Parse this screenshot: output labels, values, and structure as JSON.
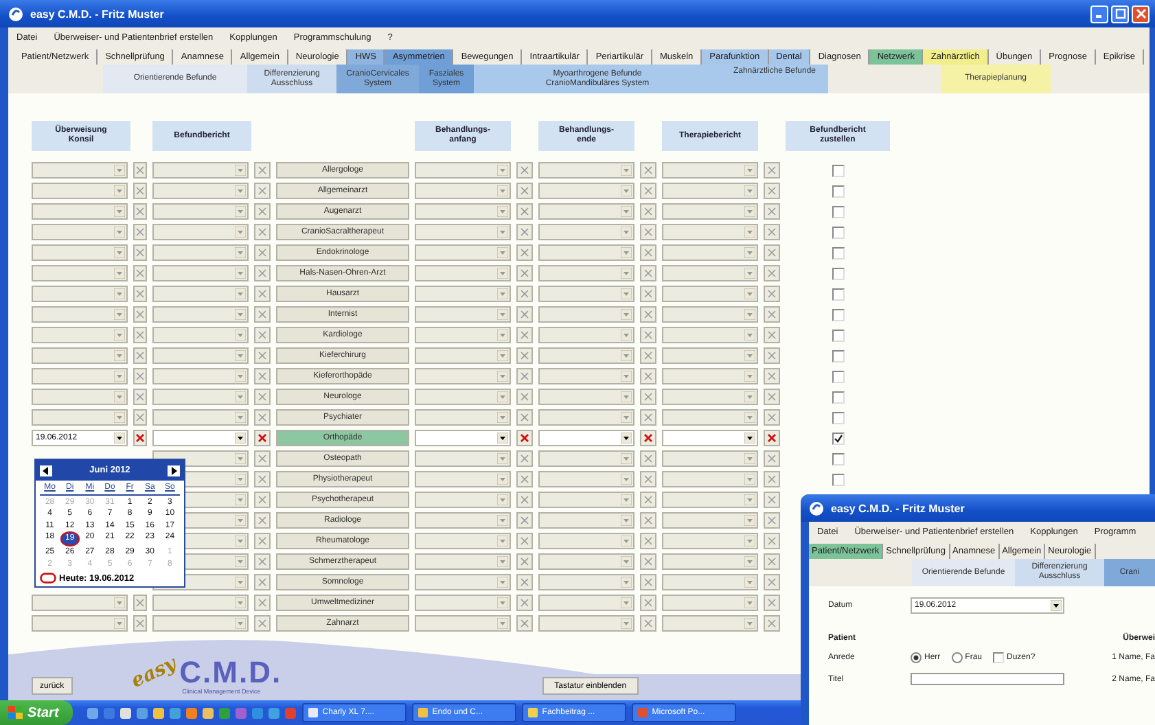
{
  "window": {
    "title": "easy C.M.D. - Fritz Muster"
  },
  "menu": [
    "Datei",
    "Überweiser- und Patientenbrief erstellen",
    "Kopplungen",
    "Programmschulung",
    "?"
  ],
  "tabs": [
    {
      "label": "Patient/Netzwerk",
      "selected": false
    },
    {
      "label": "Schnellprüfung",
      "selected": false
    },
    {
      "label": "Anamnese",
      "selected": false
    },
    {
      "label": "Allgemein",
      "selected": false
    },
    {
      "label": "Neurologie",
      "selected": false
    },
    {
      "label": "HWS",
      "selected": false,
      "color": "#8fb4e0"
    },
    {
      "label": "Asymmetrien",
      "selected": false,
      "color": "#6f9fd6"
    },
    {
      "label": "Bewegungen",
      "selected": false
    },
    {
      "label": "Intraartikulär",
      "selected": false
    },
    {
      "label": "Periartikulär",
      "selected": false
    },
    {
      "label": "Muskeln",
      "selected": false
    },
    {
      "label": "Parafunktion",
      "selected": false,
      "color": "#a6c6ea"
    },
    {
      "label": "Dental",
      "selected": false,
      "color": "#a6c6ea"
    },
    {
      "label": "Diagnosen",
      "selected": false
    },
    {
      "label": "Netzwerk",
      "selected": true
    },
    {
      "label": "Zahnärztlich",
      "selected": false,
      "color": "#f2ee8c"
    },
    {
      "label": "Übungen",
      "selected": false
    },
    {
      "label": "Prognose",
      "selected": false
    },
    {
      "label": "Epikrise",
      "selected": false
    }
  ],
  "subtabs": [
    {
      "label": "Orientierende Befunde",
      "color": "#e3e9f2"
    },
    {
      "label": "Differenzierung\nAusschluss",
      "color": "#cddcee"
    },
    {
      "label": "CranioCervicales\nSystem",
      "color": "#7fa9d9"
    },
    {
      "label": "Fasziales\nSystem",
      "color": "#6f9fd6"
    },
    {
      "label": "Myoarthrogene Befunde\nCranioMandibuläres System",
      "color": "#a9c9ec"
    },
    {
      "label": "Zahnärztliche Befunde",
      "color": "#a9c9ec"
    },
    {
      "label": "Therapieplanung",
      "color": "#f5f2a6"
    }
  ],
  "columns": [
    "Überweisung\nKonsil",
    "Befundbericht",
    "Behandlungs-\nanfang",
    "Behandlungs-\nende",
    "Therapiebericht",
    "Befundbericht\nzustellen"
  ],
  "rows": [
    {
      "name": "Allergologe",
      "selected": false,
      "checked": false
    },
    {
      "name": "Allgemeinarzt",
      "selected": false,
      "checked": false
    },
    {
      "name": "Augenarzt",
      "selected": false,
      "checked": false
    },
    {
      "name": "CranioSacraltherapeut",
      "selected": false,
      "checked": false
    },
    {
      "name": "Endokrinologe",
      "selected": false,
      "checked": false
    },
    {
      "name": "Hals-Nasen-Ohren-Arzt",
      "selected": false,
      "checked": false
    },
    {
      "name": "Hausarzt",
      "selected": false,
      "checked": false
    },
    {
      "name": "Internist",
      "selected": false,
      "checked": false
    },
    {
      "name": "Kardiologe",
      "selected": false,
      "checked": false
    },
    {
      "name": "Kieferchirurg",
      "selected": false,
      "checked": false
    },
    {
      "name": "Kieferorthopäde",
      "selected": false,
      "checked": false
    },
    {
      "name": "Neurologe",
      "selected": false,
      "checked": false
    },
    {
      "name": "Psychiater",
      "selected": false,
      "checked": false
    },
    {
      "name": "Orthopäde",
      "selected": true,
      "checked": true,
      "date": "19.06.2012"
    },
    {
      "name": "Osteopath",
      "selected": false,
      "checked": false
    },
    {
      "name": "Physiotherapeut",
      "selected": false,
      "checked": false
    },
    {
      "name": "Psychotherapeut",
      "selected": false
    },
    {
      "name": "Radiologe",
      "selected": false
    },
    {
      "name": "Rheumatologe",
      "selected": false
    },
    {
      "name": "Schmerztherapeut",
      "selected": false
    },
    {
      "name": "Somnologe",
      "selected": false
    },
    {
      "name": "Umweltmediziner",
      "selected": false
    },
    {
      "name": "Zahnarzt",
      "selected": false
    }
  ],
  "calendar": {
    "month": "Juni 2012",
    "weekdays": [
      "Mo",
      "Di",
      "Mi",
      "Do",
      "Fr",
      "Sa",
      "So"
    ],
    "weeks": [
      [
        {
          "day": "28",
          "muted": true,
          "selected": false
        },
        {
          "day": "29",
          "muted": true,
          "selected": false
        },
        {
          "day": "30",
          "muted": true,
          "selected": false
        },
        {
          "day": "31",
          "muted": true,
          "selected": false
        },
        {
          "day": "1",
          "muted": false,
          "selected": false
        },
        {
          "day": "2",
          "muted": false,
          "selected": false
        },
        {
          "day": "3",
          "muted": false,
          "selected": false
        }
      ],
      [
        {
          "day": "4",
          "muted": false,
          "selected": false
        },
        {
          "day": "5",
          "muted": false,
          "selected": false
        },
        {
          "day": "6",
          "muted": false,
          "selected": false
        },
        {
          "day": "7",
          "muted": false,
          "selected": false
        },
        {
          "day": "8",
          "muted": false,
          "selected": false
        },
        {
          "day": "9",
          "muted": false,
          "selected": false
        },
        {
          "day": "10",
          "muted": false,
          "selected": false
        }
      ],
      [
        {
          "day": "11",
          "muted": false,
          "selected": false
        },
        {
          "day": "12",
          "muted": false,
          "selected": false
        },
        {
          "day": "13",
          "muted": false,
          "selected": false
        },
        {
          "day": "14",
          "muted": false,
          "selected": false
        },
        {
          "day": "15",
          "muted": false,
          "selected": false
        },
        {
          "day": "16",
          "muted": false,
          "selected": false
        },
        {
          "day": "17",
          "muted": false,
          "selected": false
        }
      ],
      [
        {
          "day": "18",
          "muted": false,
          "selected": false
        },
        {
          "day": "19",
          "muted": false,
          "selected": true
        },
        {
          "day": "20",
          "muted": false,
          "selected": false
        },
        {
          "day": "21",
          "muted": false,
          "selected": false
        },
        {
          "day": "22",
          "muted": false,
          "selected": false
        },
        {
          "day": "23",
          "muted": false,
          "selected": false
        },
        {
          "day": "24",
          "muted": false,
          "selected": false
        }
      ],
      [
        {
          "day": "25",
          "muted": false,
          "selected": false
        },
        {
          "day": "26",
          "muted": false,
          "selected": false
        },
        {
          "day": "27",
          "muted": false,
          "selected": false
        },
        {
          "day": "28",
          "muted": false,
          "selected": false
        },
        {
          "day": "29",
          "muted": false,
          "selected": false
        },
        {
          "day": "30",
          "muted": false,
          "selected": false
        },
        {
          "day": "1",
          "muted": true,
          "selected": false
        }
      ],
      [
        {
          "day": "2",
          "muted": true,
          "selected": false
        },
        {
          "day": "3",
          "muted": true,
          "selected": false
        },
        {
          "day": "4",
          "muted": true,
          "selected": false
        },
        {
          "day": "5",
          "muted": true,
          "selected": false
        },
        {
          "day": "6",
          "muted": true,
          "selected": false
        },
        {
          "day": "7",
          "muted": true,
          "selected": false
        },
        {
          "day": "8",
          "muted": true,
          "selected": false
        }
      ]
    ],
    "today": "Heute: 19.06.2012"
  },
  "buttons": {
    "back": "zurück",
    "keyboard": "Tastatur einblenden"
  },
  "logo": {
    "script": "easy",
    "name": "C.M.D.",
    "tagline": "Clinical Management Device"
  },
  "taskbar": {
    "start": "Start",
    "tasks": [
      "Charly XL 7....",
      "Endo und C...",
      "Fachbeitrag ...",
      "Microsoft Po..."
    ]
  },
  "second_window": {
    "title": "easy C.M.D. - Fritz Muster",
    "menu": [
      "Datei",
      "Überweiser- und Patientenbrief erstellen",
      "Kopplungen",
      "Programm"
    ],
    "tabs": [
      {
        "label": "Patient/Netzwerk",
        "selected": true
      },
      {
        "label": "Schnellprüfung",
        "selected": false
      },
      {
        "label": "Anamnese",
        "selected": false
      },
      {
        "label": "Allgemein",
        "selected": false
      },
      {
        "label": "Neurologie",
        "selected": false
      }
    ],
    "subtabs": [
      {
        "label": "Orientierende Befunde",
        "color": "#e3e9f2"
      },
      {
        "label": "Differenzierung\nAusschluss",
        "color": "#cddcee"
      },
      {
        "label": "Crani",
        "color": "#7fa9d9"
      }
    ],
    "date_label": "Datum",
    "date": "19.06.2012",
    "patient_heading": "Patient",
    "referrer_heading": "Überwei",
    "salutation_label": "Anrede",
    "salutation": [
      {
        "label": "Herr",
        "selected": true
      },
      {
        "label": "Frau",
        "selected": false
      }
    ],
    "informal": {
      "label": "Duzen?",
      "checked": false
    },
    "title_label": "Titel",
    "referrers": [
      "1 Name, Fa",
      "2 Name, Fa"
    ]
  }
}
